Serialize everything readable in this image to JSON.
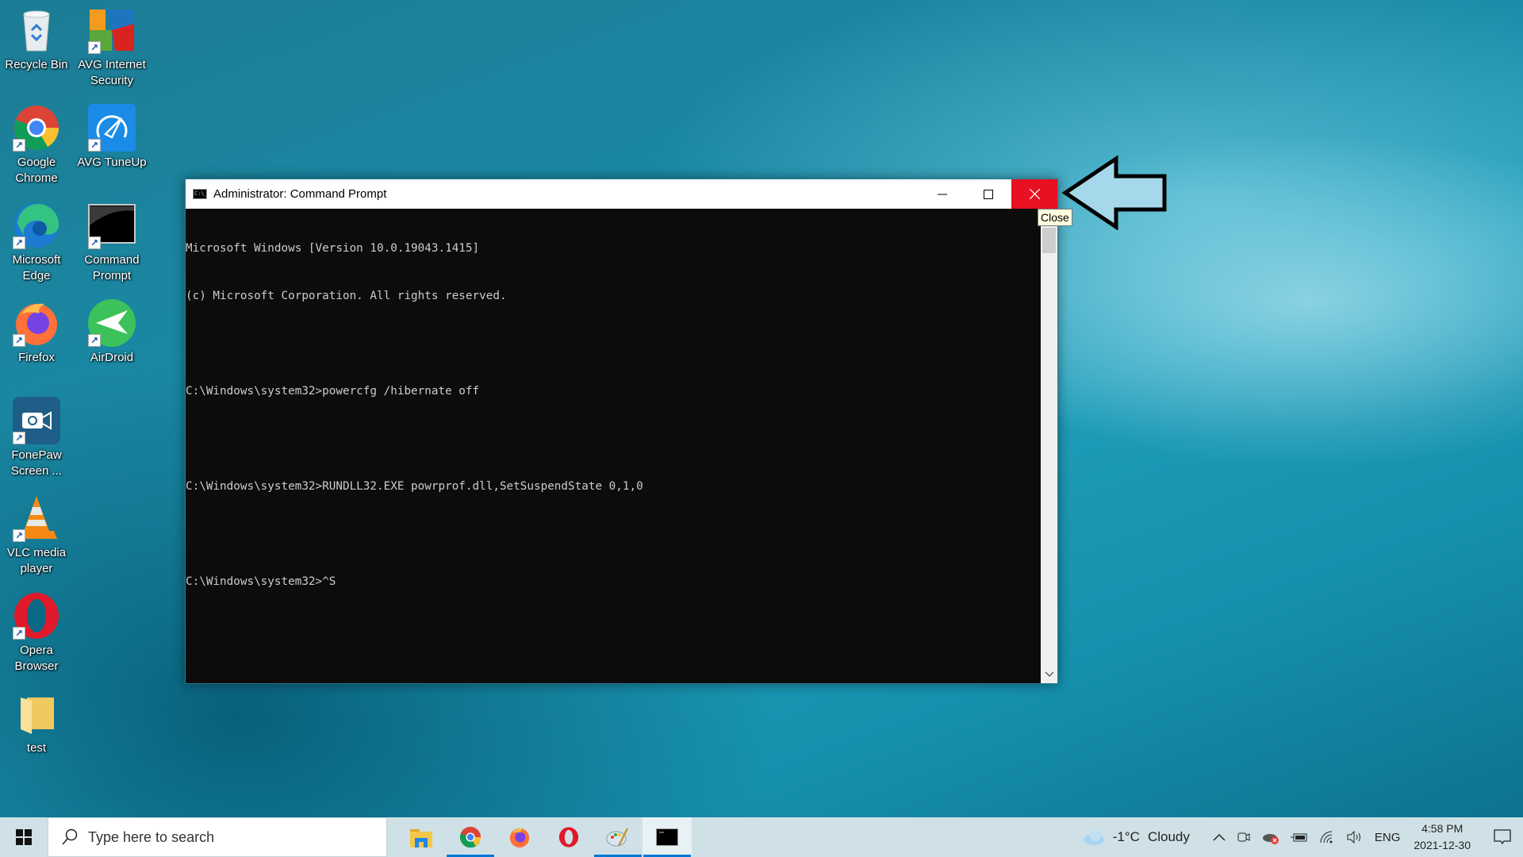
{
  "desktop": {
    "icons": [
      {
        "label": "Recycle Bin",
        "icon": "recycle-bin-icon",
        "shortcut": false
      },
      {
        "label": "AVG Internet Security",
        "icon": "avg-internet-security-icon",
        "shortcut": true
      },
      {
        "label": "Google Chrome",
        "icon": "chrome-icon",
        "shortcut": true
      },
      {
        "label": "AVG TuneUp",
        "icon": "avg-tuneup-icon",
        "shortcut": true
      },
      {
        "label": "Microsoft Edge",
        "icon": "edge-icon",
        "shortcut": true
      },
      {
        "label": "Command Prompt",
        "icon": "command-prompt-icon",
        "shortcut": true
      },
      {
        "label": "Firefox",
        "icon": "firefox-icon",
        "shortcut": true
      },
      {
        "label": "AirDroid",
        "icon": "airdroid-icon",
        "shortcut": true
      },
      {
        "label": "FonePaw Screen ...",
        "icon": "fonepaw-icon",
        "shortcut": true
      },
      {
        "label": "VLC media player",
        "icon": "vlc-icon",
        "shortcut": true
      },
      {
        "label": "Opera Browser",
        "icon": "opera-icon",
        "shortcut": true
      },
      {
        "label": "test",
        "icon": "folder-icon",
        "shortcut": false
      }
    ]
  },
  "window": {
    "title": "Administrator: Command Prompt",
    "icon": "cmd-icon",
    "controls": {
      "minimize": "Minimize",
      "maximize": "Maximize",
      "close": "Close"
    },
    "close_color": "#e81123",
    "console_lines": [
      "Microsoft Windows [Version 10.0.19043.1415]",
      "(c) Microsoft Corporation. All rights reserved.",
      "",
      "C:\\Windows\\system32>powercfg /hibernate off",
      "",
      "C:\\Windows\\system32>RUNDLL32.EXE powrprof.dll,SetSuspendState 0,1,0",
      "",
      "C:\\Windows\\system32>^S"
    ]
  },
  "tooltip": {
    "text": "Close"
  },
  "annotation": {
    "type": "arrow",
    "direction": "left",
    "fill": "#a5d8ea",
    "stroke": "#000000"
  },
  "taskbar": {
    "start_icon": "windows-start-icon",
    "search": {
      "placeholder": "Type here to search"
    },
    "apps": [
      {
        "name": "File Explorer",
        "icon": "file-explorer-icon",
        "running": false,
        "active": false
      },
      {
        "name": "Google Chrome",
        "icon": "chrome-icon",
        "running": true,
        "active": false
      },
      {
        "name": "Firefox",
        "icon": "firefox-icon",
        "running": false,
        "active": false
      },
      {
        "name": "Opera",
        "icon": "opera-icon",
        "running": false,
        "active": false
      },
      {
        "name": "Paint",
        "icon": "paint-icon",
        "running": true,
        "active": false
      },
      {
        "name": "Command Prompt",
        "icon": "command-prompt-icon",
        "running": true,
        "active": true
      }
    ],
    "weather": {
      "temp": "-1°C",
      "condition": "Cloudy"
    },
    "tray": {
      "language": "ENG",
      "time": "4:58 PM",
      "date": "2021-12-30"
    },
    "accent": "#0078d7"
  }
}
